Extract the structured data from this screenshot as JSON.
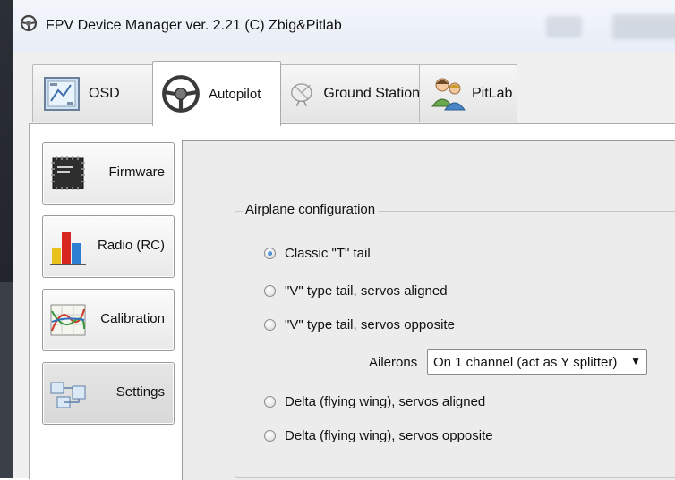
{
  "window": {
    "title": "FPV Device Manager ver. 2.21  (C) Zbig&Pitlab"
  },
  "tabs": [
    {
      "label": "OSD",
      "icon": "osd-icon",
      "active": false
    },
    {
      "label": "Autopilot",
      "icon": "steering-wheel-icon",
      "active": true
    },
    {
      "label": "Ground Station",
      "icon": "satellite-dish-icon",
      "active": false
    },
    {
      "label": "PitLab",
      "icon": "people-icon",
      "active": false
    }
  ],
  "sidebar": {
    "items": [
      {
        "label": "Firmware",
        "icon": "chip-icon"
      },
      {
        "label": "Radio (RC)",
        "icon": "bar-chart-icon"
      },
      {
        "label": "Calibration",
        "icon": "curves-icon"
      },
      {
        "label": "Settings",
        "icon": "settings-diagram-icon"
      }
    ]
  },
  "airplane_config": {
    "title": "Airplane configuration",
    "options": [
      {
        "label": "Classic \"T\" tail",
        "selected": true
      },
      {
        "label": "\"V\" type tail, servos aligned",
        "selected": false
      },
      {
        "label": "\"V\" type tail, servos opposite",
        "selected": false
      },
      {
        "label": "Delta (flying wing), servos aligned",
        "selected": false
      },
      {
        "label": "Delta (flying wing), servos opposite",
        "selected": false
      }
    ],
    "ailerons": {
      "label": "Ailerons",
      "value": "On 1 channel (act as Y splitter)"
    }
  }
}
